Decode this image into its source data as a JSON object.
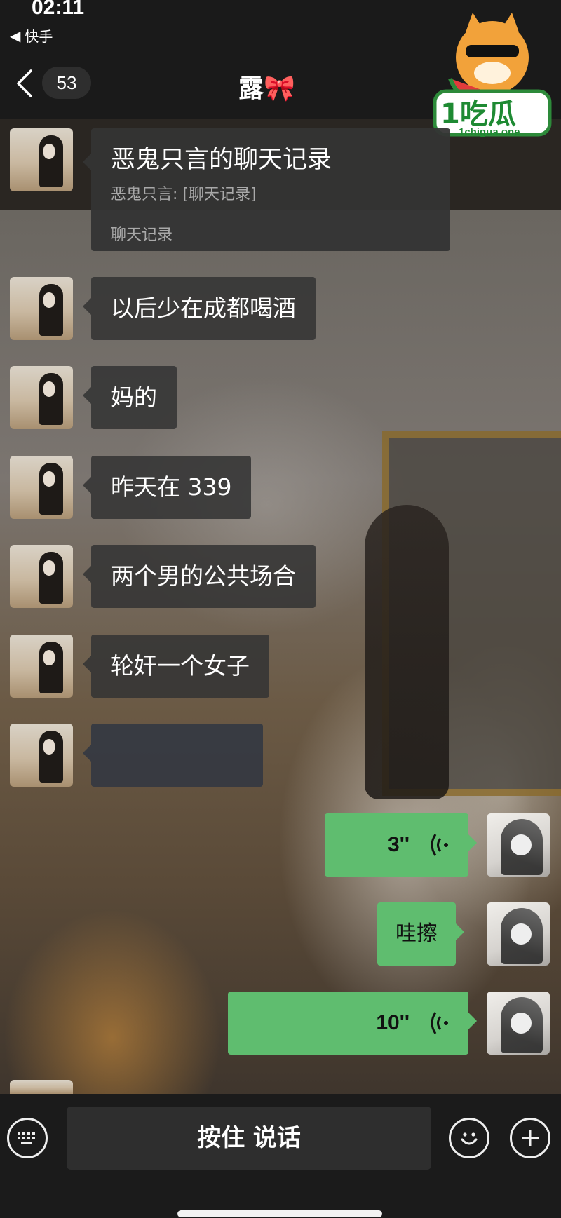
{
  "status_bar": {
    "time": "02:11",
    "back_app_label": "快手"
  },
  "nav": {
    "unread_count": "53",
    "title": "露🎀"
  },
  "logo": {
    "text": "1吃瓜",
    "url_text": "1chigua.one"
  },
  "card": {
    "title": "恶鬼只言的聊天记录",
    "subtitle": "恶鬼只言: [聊天记录]",
    "footer": "聊天记录"
  },
  "messages_left": [
    {
      "text": "以后少在成都喝酒"
    },
    {
      "text": "妈的"
    },
    {
      "text": "昨天在 339"
    },
    {
      "text": "两个男的公共场合"
    },
    {
      "text": "轮奸一个女子"
    }
  ],
  "messages_right": [
    {
      "type": "voice",
      "duration": "3''"
    },
    {
      "type": "text",
      "text": "哇擦"
    },
    {
      "type": "voice",
      "duration": "10''"
    }
  ],
  "bottom_bar": {
    "hold_to_talk": "按住 说话"
  },
  "colors": {
    "outgoing_bubble": "#5fbd6f",
    "incoming_bubble": "#343434",
    "bar_bg": "#1b1b1b"
  }
}
